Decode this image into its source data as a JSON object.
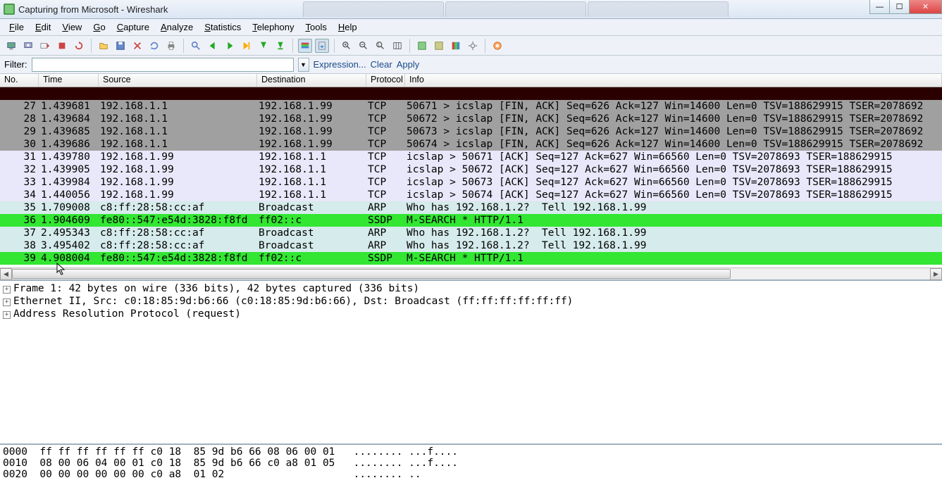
{
  "window": {
    "title": "Capturing from Microsoft - Wireshark"
  },
  "menu": [
    "File",
    "Edit",
    "View",
    "Go",
    "Capture",
    "Analyze",
    "Statistics",
    "Telephony",
    "Tools",
    "Help"
  ],
  "filter": {
    "label": "Filter:",
    "value": "",
    "links": [
      "Expression...",
      "Clear",
      "Apply"
    ]
  },
  "columns": [
    "No.",
    "Time",
    "Source",
    "Destination",
    "Protocol",
    "Info"
  ],
  "packets": [
    {
      "style": "darkred",
      "no": "",
      "time": "",
      "src": "",
      "dst": "",
      "proto": "",
      "info": ""
    },
    {
      "style": "gray",
      "no": "27",
      "time": "1.439681",
      "src": "192.168.1.1",
      "dst": "192.168.1.99",
      "proto": "TCP",
      "info": "50671 > icslap [FIN, ACK] Seq=626 Ack=127 Win=14600 Len=0 TSV=188629915 TSER=2078692"
    },
    {
      "style": "gray",
      "no": "28",
      "time": "1.439684",
      "src": "192.168.1.1",
      "dst": "192.168.1.99",
      "proto": "TCP",
      "info": "50672 > icslap [FIN, ACK] Seq=626 Ack=127 Win=14600 Len=0 TSV=188629915 TSER=2078692"
    },
    {
      "style": "gray",
      "no": "29",
      "time": "1.439685",
      "src": "192.168.1.1",
      "dst": "192.168.1.99",
      "proto": "TCP",
      "info": "50673 > icslap [FIN, ACK] Seq=626 Ack=127 Win=14600 Len=0 TSV=188629915 TSER=2078692"
    },
    {
      "style": "gray",
      "no": "30",
      "time": "1.439686",
      "src": "192.168.1.1",
      "dst": "192.168.1.99",
      "proto": "TCP",
      "info": "50674 > icslap [FIN, ACK] Seq=626 Ack=127 Win=14600 Len=0 TSV=188629915 TSER=2078692"
    },
    {
      "style": "lav",
      "no": "31",
      "time": "1.439780",
      "src": "192.168.1.99",
      "dst": "192.168.1.1",
      "proto": "TCP",
      "info": "icslap > 50671 [ACK] Seq=127 Ack=627 Win=66560 Len=0 TSV=2078693 TSER=188629915"
    },
    {
      "style": "lav",
      "no": "32",
      "time": "1.439905",
      "src": "192.168.1.99",
      "dst": "192.168.1.1",
      "proto": "TCP",
      "info": "icslap > 50672 [ACK] Seq=127 Ack=627 Win=66560 Len=0 TSV=2078693 TSER=188629915"
    },
    {
      "style": "lav",
      "no": "33",
      "time": "1.439984",
      "src": "192.168.1.99",
      "dst": "192.168.1.1",
      "proto": "TCP",
      "info": "icslap > 50673 [ACK] Seq=127 Ack=627 Win=66560 Len=0 TSV=2078693 TSER=188629915"
    },
    {
      "style": "lav",
      "no": "34",
      "time": "1.440056",
      "src": "192.168.1.99",
      "dst": "192.168.1.1",
      "proto": "TCP",
      "info": "icslap > 50674 [ACK] Seq=127 Ack=627 Win=66560 Len=0 TSV=2078693 TSER=188629915"
    },
    {
      "style": "teal",
      "no": "35",
      "time": "1.709008",
      "src": "c8:ff:28:58:cc:af",
      "dst": "Broadcast",
      "proto": "ARP",
      "info": "Who has 192.168.1.2?  Tell 192.168.1.99"
    },
    {
      "style": "green",
      "no": "36",
      "time": "1.904609",
      "src": "fe80::547:e54d:3828:f8fd",
      "dst": "ff02::c",
      "proto": "SSDP",
      "info": "M-SEARCH * HTTP/1.1"
    },
    {
      "style": "teal",
      "no": "37",
      "time": "2.495343",
      "src": "c8:ff:28:58:cc:af",
      "dst": "Broadcast",
      "proto": "ARP",
      "info": "Who has 192.168.1.2?  Tell 192.168.1.99"
    },
    {
      "style": "teal",
      "no": "38",
      "time": "3.495402",
      "src": "c8:ff:28:58:cc:af",
      "dst": "Broadcast",
      "proto": "ARP",
      "info": "Who has 192.168.1.2?  Tell 192.168.1.99"
    },
    {
      "style": "green",
      "no": "39",
      "time": "4.908004",
      "src": "fe80::547:e54d:3828:f8fd",
      "dst": "ff02::c",
      "proto": "SSDP",
      "info": "M-SEARCH * HTTP/1.1"
    }
  ],
  "tree": [
    "Frame 1: 42 bytes on wire (336 bits), 42 bytes captured (336 bits)",
    "Ethernet II, Src: c0:18:85:9d:b6:66 (c0:18:85:9d:b6:66), Dst: Broadcast (ff:ff:ff:ff:ff:ff)",
    "Address Resolution Protocol (request)"
  ],
  "hex": [
    {
      "off": "0000",
      "bytes": "ff ff ff ff ff ff c0 18  85 9d b6 66 08 06 00 01",
      "ascii": "........ ...f...."
    },
    {
      "off": "0010",
      "bytes": "08 00 06 04 00 01 c0 18  85 9d b6 66 c0 a8 01 05",
      "ascii": "........ ...f...."
    },
    {
      "off": "0020",
      "bytes": "00 00 00 00 00 00 c0 a8  01 02",
      "ascii": "........ .."
    }
  ]
}
